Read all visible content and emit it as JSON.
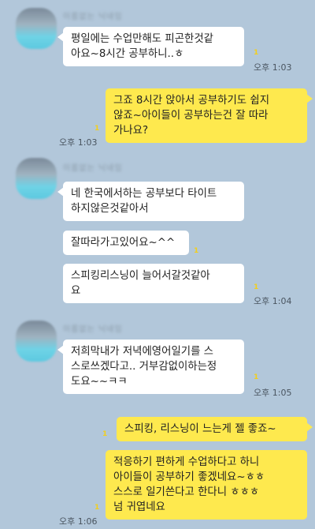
{
  "colors": {
    "background": "#b2c7da",
    "incoming_bubble": "#ffffff",
    "outgoing_bubble": "#fee94e",
    "unread": "#f2cf1d"
  },
  "unread_mark": "1",
  "messages": [
    {
      "sender": "이름없는 닉네임",
      "text": "평일에는 수업만해도 피곤한것같\n아요~8시간 공부하니..ㅎ",
      "time": "오후 1:03"
    },
    {
      "text": "그죠 8시간 앉아서 공부하기도 쉽지\n않죠~아이들이 공부하는건 잘 따라\n가나요?",
      "time": "오후 1:03"
    },
    {
      "sender": "이름없는 닉네임",
      "text": "네 한국에서하는 공부보다 타이트\n하지않은것같아서"
    },
    {
      "text": "잘따라가고있어요~^^"
    },
    {
      "text": "스피킹리스닝이 늘어서갈것같아\n요",
      "time": "오후 1:04"
    },
    {
      "sender": "이름없는 닉네임",
      "text": "저희막내가 저녁에영어일기를 스\n스로쓰겠다고.. 거부감없이하는정\n도요~~ㅋㅋ",
      "time": "오후 1:05"
    },
    {
      "text": "스피킹, 리스닝이 느는게 젤 좋죠~"
    },
    {
      "text": "적응하기 편하게 수업하다고 하니\n아이들이 공부하기 좋겠네요~ㅎㅎ\n스스로 일기쓴다고 한다니 ㅎㅎㅎ\n넘 귀엽네요",
      "time": "오후 1:06"
    }
  ]
}
